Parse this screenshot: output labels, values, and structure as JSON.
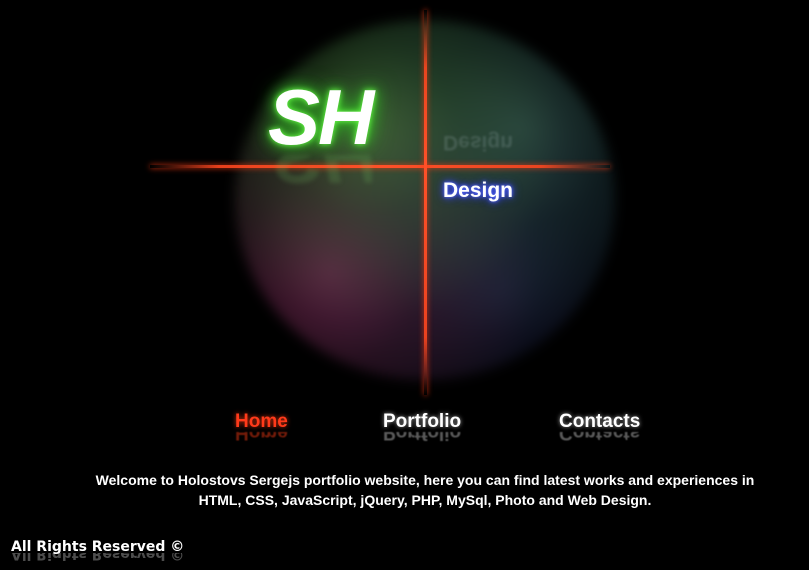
{
  "logo": {
    "initials": "SH",
    "subtitle": "Design"
  },
  "nav": {
    "items": [
      {
        "label": "Home",
        "active": true
      },
      {
        "label": "Portfolio",
        "active": false
      },
      {
        "label": "Contacts",
        "active": false
      }
    ]
  },
  "welcome": {
    "line1": "Welcome to Holostovs Sergejs portfolio website, here you can find latest works and experiences in",
    "line2": "HTML, CSS, JavaScript, jQuery, PHP, MySql, Photo and Web Design."
  },
  "footer": {
    "text": "All Rights Reserved ©"
  },
  "colors": {
    "background": "#000000",
    "accent_red": "#ff3a1a",
    "logo_glow_green": "#3cd02a",
    "design_glow_blue": "#3b48ff"
  }
}
